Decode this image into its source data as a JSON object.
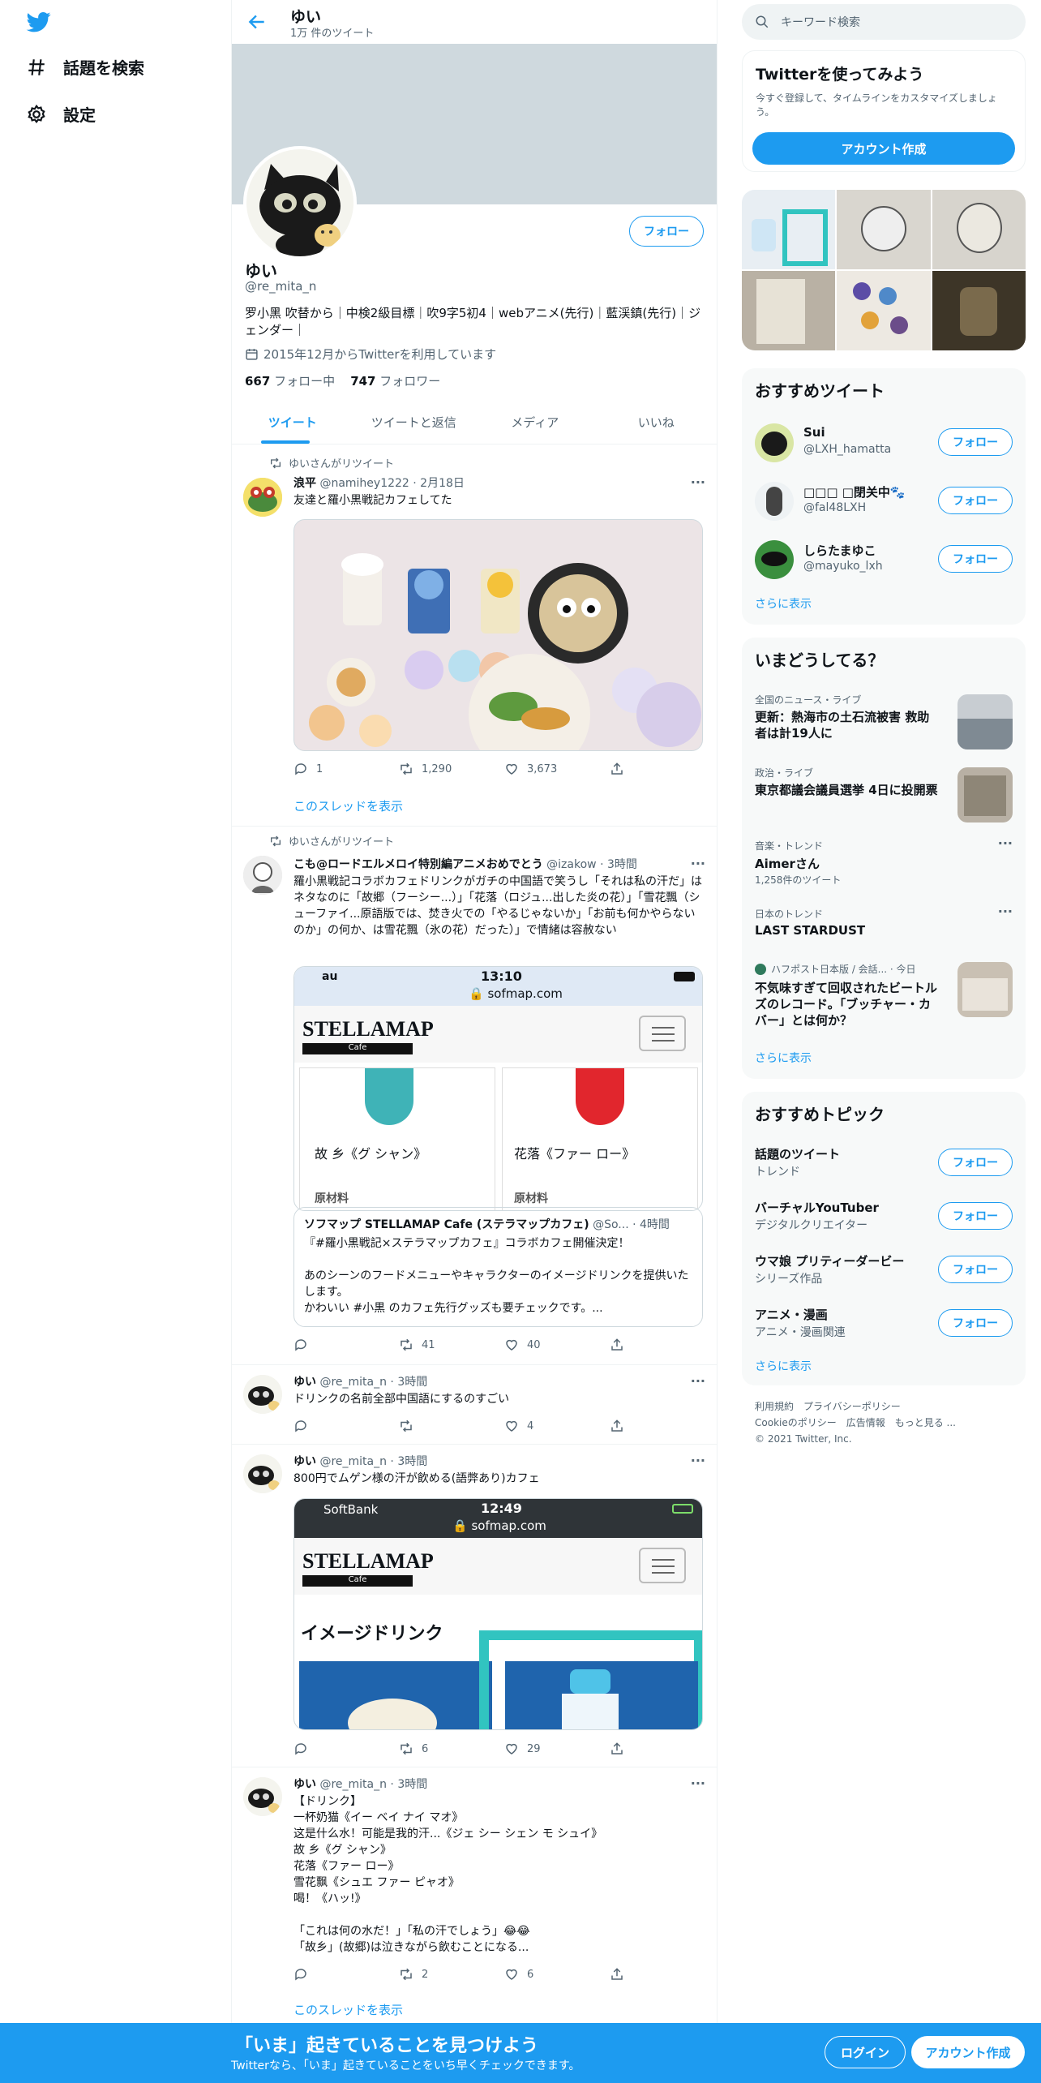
{
  "nav": {
    "explore_label": "話題を検索",
    "settings_label": "設定"
  },
  "header": {
    "title": "ゆい",
    "subtitle": "1万 件のツイート"
  },
  "profile": {
    "follow_label": "フォロー",
    "name": "ゆい",
    "handle": "@re_mita_n",
    "bio": "罗小黑 吹替から｜中検2級目標｜吹9字5初4｜webアニメ(先行)｜藍渓鎮(先行)｜ジェンダー｜",
    "joined": "2015年12月からTwitterを利用しています",
    "following_count": "667",
    "following_label": "フォロー中",
    "followers_count": "747",
    "followers_label": "フォロワー"
  },
  "tabs": [
    "ツイート",
    "ツイートと返信",
    "メディア",
    "いいね"
  ],
  "tweets": [
    {
      "retweet_label": "ゆいさんがリツイート",
      "name": "浪平",
      "handle_time": "@namihey1222 · 2月18日",
      "text": "友達と羅小黒戦記カフェしてた",
      "reply": "1",
      "retweet": "1,290",
      "like": "3,673",
      "thread": "このスレッドを表示"
    },
    {
      "retweet_label": "ゆいさんがリツイート",
      "name": "こも@ロードエルメロイ特別編アニメおめでとう",
      "handle_time": "@izakow · 3時間",
      "text": "羅小黒戦記コラボカフェドリンクがガチの中国語で笑うし「それは私の汗だ」はネタなのに「故郷（フーシー...）」「花落（ロジュ...出した炎の花）」「雪花飄（シューファイ...原語版では、焚き火での「やるじゃないか」「お前も何かやらないのか」の何か、は雪花飄（氷の花）だった）」で情緒は容赦ない",
      "screenshot": {
        "time": "13:10",
        "carrier": "au",
        "url": "sofmap.com",
        "brand": "STELLAMAP",
        "brand_sub": "Cafe",
        "drink1": "故 乡《グ シャン》",
        "drink2": "花落《ファー ロー》",
        "cut_text": "原材料"
      },
      "quote": {
        "name": "ソフマップ STELLAMAP Cafe (ステラマップカフェ)",
        "handle_time": "@So... · 4時間",
        "text": "『#羅小黒戦記×ステラマップカフェ』コラボカフェ開催決定！\n\nあのシーンのフードメニューやキャラクターのイメージドリンクを提供いたします。\nかわいい #小黒 のカフェ先行グッズも要チェックです。..."
      },
      "reply": "",
      "retweet": "41",
      "like": "40"
    },
    {
      "name": "ゆい",
      "handle_time": "@re_mita_n · 3時間",
      "text": "ドリンクの名前全部中国語にするのすごい",
      "reply": "",
      "retweet": "",
      "like": "4"
    },
    {
      "name": "ゆい",
      "handle_time": "@re_mita_n · 3時間",
      "text": "800円でムゲン様の汗が飲める(語弊あり)カフェ",
      "screenshot": {
        "time": "12:49",
        "carrier": "SoftBank",
        "url": "sofmap.com",
        "brand": "STELLAMAP",
        "brand_sub": "Cafe",
        "heading": "イメージドリンク"
      },
      "reply": "",
      "retweet": "6",
      "like": "29"
    },
    {
      "name": "ゆい",
      "handle_time": "@re_mita_n · 3時間",
      "text": "【ドリンク】\n一杯奶猫《イー ベイ ナイ マオ》\n这是什么水！可能是我的汗...《ジェ シー シェン モ シュイ》\n故 乡《グ シャン》\n花落《ファー ロー》\n雪花飘《シュエ ファー ピャオ》\n喝！《ハッ!》\n\n「これは何の水だ！」「私の汗でしょう」😂😂\n「故乡」(故郷)は泣きながら飲むことになる...",
      "reply": "",
      "retweet": "2",
      "like": "6",
      "thread": "このスレッドを表示"
    }
  ],
  "right": {
    "search_placeholder": "キーワード検索",
    "signup_card": {
      "title": "Twitterを使ってみよう",
      "text": "今すぐ登録して、タイムラインをカスタマイズしましょう。",
      "button": "アカウント作成"
    },
    "recommended": {
      "title": "おすすめツイート",
      "users": [
        {
          "name": "Sui",
          "handle": "@LXH_hamatta"
        },
        {
          "name": "□□□ □閉关中🐾",
          "handle": "@fal48LXH"
        },
        {
          "name": "しらたまゆこ",
          "handle": "@mayuko_lxh"
        }
      ],
      "follow_label": "フォロー",
      "show_more": "さらに表示"
    },
    "trends": {
      "title": "いまどうしてる？",
      "items": [
        {
          "meta": "全国のニュース・ライブ",
          "title": "更新：熱海市の土石流被害 救助者は計19人に"
        },
        {
          "meta": "政治・ライブ",
          "title": "東京都議会議員選挙 4日に投開票"
        },
        {
          "meta": "音楽・トレンド",
          "title": "Aimerさん",
          "count": "1,258件のツイート"
        },
        {
          "meta": "日本のトレンド",
          "title": "LAST STARDUST"
        },
        {
          "meta": "ハフポスト日本版 / 会話... · 今日",
          "title": "不気味すぎて回収されたビートルズのレコード。「ブッチャー・カバー」とは何か？"
        }
      ],
      "show_more": "さらに表示"
    },
    "topics": {
      "title": "おすすめトピック",
      "items": [
        {
          "name": "話題のツイート",
          "sub": "トレンド"
        },
        {
          "name": "バーチャルYouTuber",
          "sub": "デジタルクリエイター"
        },
        {
          "name": "ウマ娘 プリティーダービー",
          "sub": "シリーズ作品"
        },
        {
          "name": "アニメ・漫画",
          "sub": "アニメ・漫画関連"
        }
      ],
      "follow_label": "フォロー",
      "show_more": "さらに表示"
    },
    "footer": {
      "line1": "利用規約　プライバシーポリシー",
      "line2": "Cookieのポリシー　広告情報　もっと見る ...",
      "line3": "© 2021 Twitter, Inc."
    }
  },
  "bottom": {
    "headline": "「いま」起きていることを見つけよう",
    "sub": "Twitterなら、「いま」起きていることをいち早くチェックできます。",
    "login": "ログイン",
    "signup": "アカウント作成"
  },
  "colors": {
    "accent": "#1d9bf0",
    "banner": "#cfd9de"
  }
}
